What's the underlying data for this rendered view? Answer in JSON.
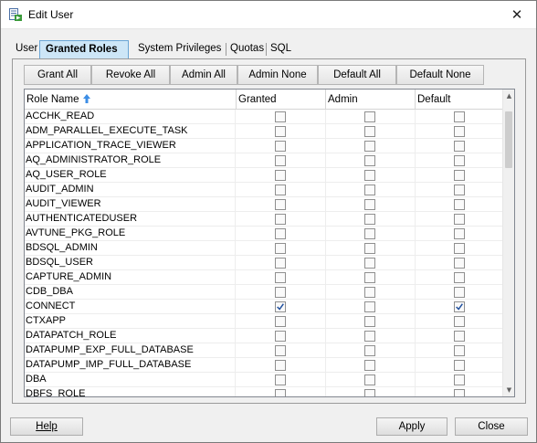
{
  "window": {
    "title": "Edit User",
    "close_glyph": "✕"
  },
  "tabs": [
    {
      "label": "User",
      "active": false
    },
    {
      "label": "Granted Roles",
      "active": true
    },
    {
      "label": "System Privileges",
      "active": false
    },
    {
      "label": "Quotas",
      "active": false
    },
    {
      "label": "SQL",
      "active": false
    }
  ],
  "toolbar": {
    "grant_all": "Grant All",
    "revoke_all": "Revoke All",
    "admin_all": "Admin All",
    "admin_none": "Admin None",
    "default_all": "Default All",
    "default_none": "Default None"
  },
  "table": {
    "columns": [
      "Role Name",
      "Granted",
      "Admin",
      "Default"
    ],
    "sort_icon": "sort-ascending-icon",
    "rows": [
      {
        "name": "ACCHK_READ",
        "granted": false,
        "admin": false,
        "default": false
      },
      {
        "name": "ADM_PARALLEL_EXECUTE_TASK",
        "granted": false,
        "admin": false,
        "default": false
      },
      {
        "name": "APPLICATION_TRACE_VIEWER",
        "granted": false,
        "admin": false,
        "default": false
      },
      {
        "name": "AQ_ADMINISTRATOR_ROLE",
        "granted": false,
        "admin": false,
        "default": false
      },
      {
        "name": "AQ_USER_ROLE",
        "granted": false,
        "admin": false,
        "default": false
      },
      {
        "name": "AUDIT_ADMIN",
        "granted": false,
        "admin": false,
        "default": false
      },
      {
        "name": "AUDIT_VIEWER",
        "granted": false,
        "admin": false,
        "default": false
      },
      {
        "name": "AUTHENTICATEDUSER",
        "granted": false,
        "admin": false,
        "default": false
      },
      {
        "name": "AVTUNE_PKG_ROLE",
        "granted": false,
        "admin": false,
        "default": false
      },
      {
        "name": "BDSQL_ADMIN",
        "granted": false,
        "admin": false,
        "default": false
      },
      {
        "name": "BDSQL_USER",
        "granted": false,
        "admin": false,
        "default": false
      },
      {
        "name": "CAPTURE_ADMIN",
        "granted": false,
        "admin": false,
        "default": false
      },
      {
        "name": "CDB_DBA",
        "granted": false,
        "admin": false,
        "default": false
      },
      {
        "name": "CONNECT",
        "granted": true,
        "admin": false,
        "default": true
      },
      {
        "name": "CTXAPP",
        "granted": false,
        "admin": false,
        "default": false
      },
      {
        "name": "DATAPATCH_ROLE",
        "granted": false,
        "admin": false,
        "default": false
      },
      {
        "name": "DATAPUMP_EXP_FULL_DATABASE",
        "granted": false,
        "admin": false,
        "default": false
      },
      {
        "name": "DATAPUMP_IMP_FULL_DATABASE",
        "granted": false,
        "admin": false,
        "default": false
      },
      {
        "name": "DBA",
        "granted": false,
        "admin": false,
        "default": false
      },
      {
        "name": "DBFS_ROLE",
        "granted": false,
        "admin": false,
        "default": false
      }
    ]
  },
  "footer": {
    "help": "Help",
    "apply": "Apply",
    "close": "Close"
  },
  "colors": {
    "active_tab_bg": "#cde6f7",
    "checkmark": "#1f4f9e"
  }
}
